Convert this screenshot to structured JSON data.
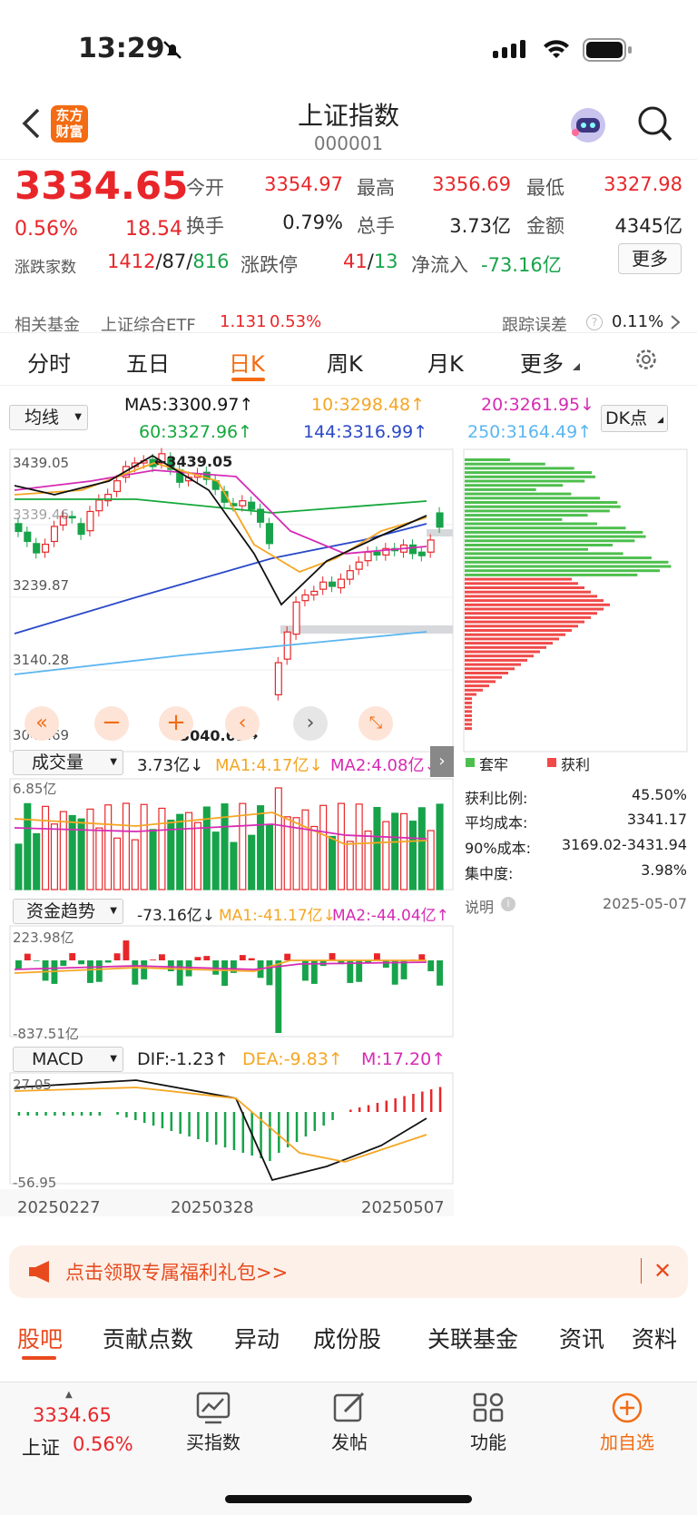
{
  "status": {
    "time": "13:29"
  },
  "header": {
    "title": "上证指数",
    "code": "000001",
    "logo_line1": "东方",
    "logo_line2": "财富"
  },
  "quote": {
    "price": "3334.65",
    "pct": "0.56%",
    "change": "18.54",
    "row1": [
      {
        "l": "今开",
        "v": "3354.97"
      },
      {
        "l": "最高",
        "v": "3356.69"
      },
      {
        "l": "最低",
        "v": "3327.98"
      }
    ],
    "row2": [
      {
        "l": "换手",
        "v": "0.79%"
      },
      {
        "l": "总手",
        "v": "3.73亿"
      },
      {
        "l": "金额",
        "v": "4345亿"
      }
    ],
    "breadth_label": "涨跌家数",
    "up": "1412",
    "flat": "87",
    "down": "816",
    "sep": "/",
    "limit_label": "涨跌停",
    "limit_up": "41",
    "limit_down": "13",
    "flow_label": "净流入",
    "flow": "-73.16亿",
    "more": "更多"
  },
  "fund": {
    "label": "相关基金",
    "name": "上证综合ETF",
    "price": "1.131",
    "pct": "0.53%",
    "track_label": "跟踪误差",
    "track": "0.11%"
  },
  "tabs": [
    "分时",
    "五日",
    "日K",
    "周K",
    "月K",
    "更多"
  ],
  "ma": {
    "selector": "均线",
    "ma5": "MA5:3300.97↑",
    "ma10": "10:3298.48↑",
    "ma20": "20:3261.95↓",
    "ma60": "60:3327.96↑",
    "ma144": "144:3316.99↑",
    "ma250": "250:3164.49↑",
    "dk": "DK点"
  },
  "kchart": {
    "y_top": "3439.05",
    "y_mid": "3339.46",
    "y_low": "3239.87",
    "y_low2": "3140.28",
    "y_bottom": "3040.69",
    "hi_label": "3439.05",
    "lo_label": "3040.69"
  },
  "volume": {
    "selector": "成交量",
    "value": "3.73亿↓",
    "ma1": "MA1:4.17亿↓",
    "ma2": "MA2:4.08亿↓",
    "ymax": "6.85亿"
  },
  "flow": {
    "selector": "资金趋势",
    "value": "-73.16亿↓",
    "ma1": "MA1:-41.17亿↓",
    "ma2": "MA2:-44.04亿↑",
    "ymax": "223.98亿",
    "ymin": "-837.51亿"
  },
  "macd": {
    "selector": "MACD",
    "dif": "DIF:-1.23↑",
    "dea": "DEA:-9.83↑",
    "m": "M:17.20↑",
    "ymax": "27.05",
    "ymin": "-56.95"
  },
  "dates": [
    "20250227",
    "20250328",
    "20250507"
  ],
  "chips": {
    "legend_trap": "套牢",
    "legend_profit": "获利",
    "rows": [
      {
        "l": "获利比例:",
        "v": "45.50%"
      },
      {
        "l": "平均成本:",
        "v": "3341.17"
      },
      {
        "l": "90%成本:",
        "v": "3169.02-3431.94"
      },
      {
        "l": "集中度:",
        "v": "3.98%"
      }
    ],
    "note": "说明",
    "date": "2025-05-07"
  },
  "banner": {
    "text": "点击领取专属福利礼包>>"
  },
  "bottom_tabs": [
    "股吧",
    "贡献点数",
    "异动",
    "成份股",
    "关联基金",
    "资讯",
    "资料"
  ],
  "nav": {
    "price": "3334.65",
    "name": "上证",
    "pct": "0.56%",
    "items": [
      "买指数",
      "发帖",
      "功能",
      "加自选"
    ]
  },
  "colors": {
    "up": "#e8262a",
    "down": "#17a34a",
    "accent": "#f36b12"
  }
}
